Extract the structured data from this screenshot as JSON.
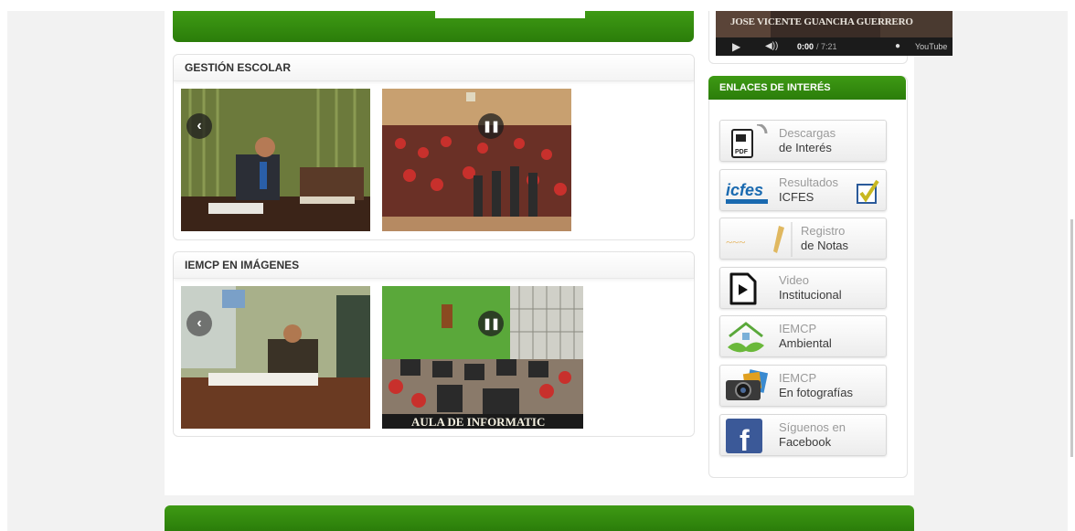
{
  "panels": {
    "gestion": {
      "title": "GESTIÓN ESCOLAR"
    },
    "imagenes": {
      "title": "IEMCP EN IMÁGENES",
      "photo_caption": "AULA DE INFORMATIC"
    }
  },
  "video": {
    "title": "JOSE VICENTE GUANCHA GUERRERO",
    "time_current": "0:00",
    "time_total": "/ 7:21",
    "brand": "YouTube"
  },
  "sidebar": {
    "title": "ENLACES DE INTERÉS",
    "links": [
      {
        "line1": "Descargas",
        "line2": "de Interés",
        "icon": "pdf-document-icon"
      },
      {
        "line1": "Resultados",
        "line2": "ICFES",
        "icon": "icfes-logo-icon",
        "icon_text": "icfes"
      },
      {
        "line1": "Registro",
        "line2": "de Notas",
        "icon": "pencil-notes-icon"
      },
      {
        "line1": "Video",
        "line2": "Institucional",
        "icon": "video-play-icon"
      },
      {
        "line1": "IEMCP",
        "line2": "Ambiental",
        "icon": "environment-house-icon"
      },
      {
        "line1": "IEMCP",
        "line2": "En fotografías",
        "icon": "camera-icon"
      },
      {
        "line1": "Síguenos en",
        "line2": "Facebook",
        "icon": "facebook-icon"
      }
    ]
  },
  "colors": {
    "green": "#2b7d0a",
    "green_light": "#3e9a14",
    "facebook_blue": "#3b5998"
  }
}
